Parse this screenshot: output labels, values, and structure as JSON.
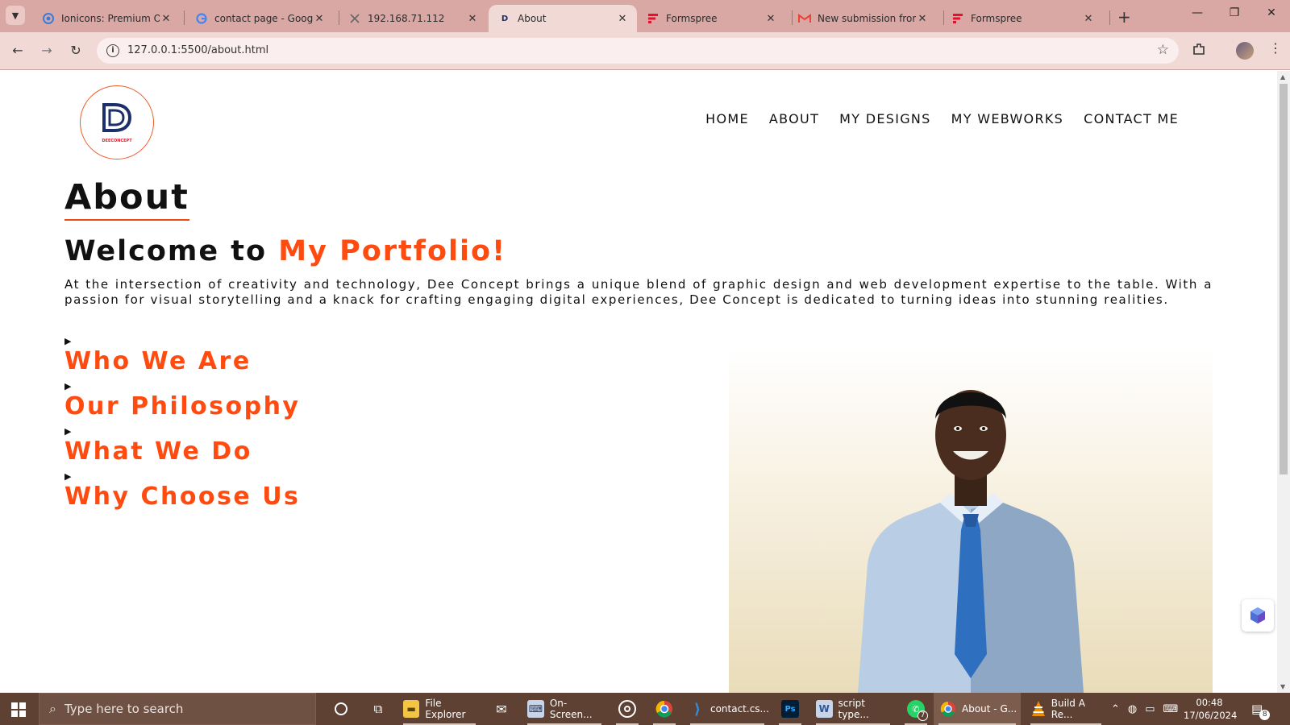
{
  "browser": {
    "tabs": [
      {
        "title": "Ionicons: Premium Op",
        "favicon": "ionicons-icon",
        "active": false
      },
      {
        "title": "contact page - Google",
        "favicon": "google-icon",
        "active": false
      },
      {
        "title": "192.168.71.112",
        "favicon": "broken-page-icon",
        "active": false
      },
      {
        "title": "About",
        "favicon": "dee-concept-favicon",
        "active": true
      },
      {
        "title": "Formspree",
        "favicon": "formspree-icon",
        "active": false
      },
      {
        "title": "New submission from",
        "favicon": "gmail-icon",
        "active": false
      },
      {
        "title": "Formspree",
        "favicon": "formspree-icon",
        "active": false
      }
    ],
    "url": "127.0.0.1:5500/about.html"
  },
  "site": {
    "logo_text": "DEECONCEPT",
    "nav": [
      "HOME",
      "ABOUT",
      "MY DESIGNS",
      "MY WEBWORKS",
      "CONTACT ME"
    ],
    "page_title": "About",
    "welcome_prefix": "Welcome to ",
    "welcome_highlight": "My Portfolio!",
    "intro": "At the intersection of creativity and technology, Dee Concept brings a unique blend of graphic design and web development expertise to the table. With a passion for visual storytelling and a knack for crafting engaging digital experiences, Dee Concept is dedicated to turning ideas into stunning realities.",
    "sections": [
      "Who We Are",
      "Our Philosophy",
      "What We Do",
      "Why Choose Us"
    ],
    "accent_color": "#ff4b0f"
  },
  "taskbar": {
    "search_placeholder": "Type here to search",
    "items": [
      {
        "label": "",
        "icon": "cortana-icon"
      },
      {
        "label": "",
        "icon": "task-view-icon"
      },
      {
        "label": "File Explorer",
        "icon": "folder-icon"
      },
      {
        "label": "",
        "icon": "mail-icon"
      },
      {
        "label": "On-Screen...",
        "icon": "keyboard-app-icon"
      },
      {
        "label": "",
        "icon": "obs-icon"
      },
      {
        "label": "",
        "icon": "chrome-icon"
      },
      {
        "label": "contact.cs...",
        "icon": "vscode-icon"
      },
      {
        "label": "",
        "icon": "photoshop-icon"
      },
      {
        "label": "script type...",
        "icon": "word-icon"
      },
      {
        "label": "",
        "icon": "whatsapp-icon",
        "badge": "7"
      },
      {
        "label": "About - G...",
        "icon": "chrome-icon"
      },
      {
        "label": "Build A Re...",
        "icon": "vlc-icon"
      }
    ],
    "time": "00:48",
    "date": "17/06/2024",
    "notifications": "8"
  }
}
